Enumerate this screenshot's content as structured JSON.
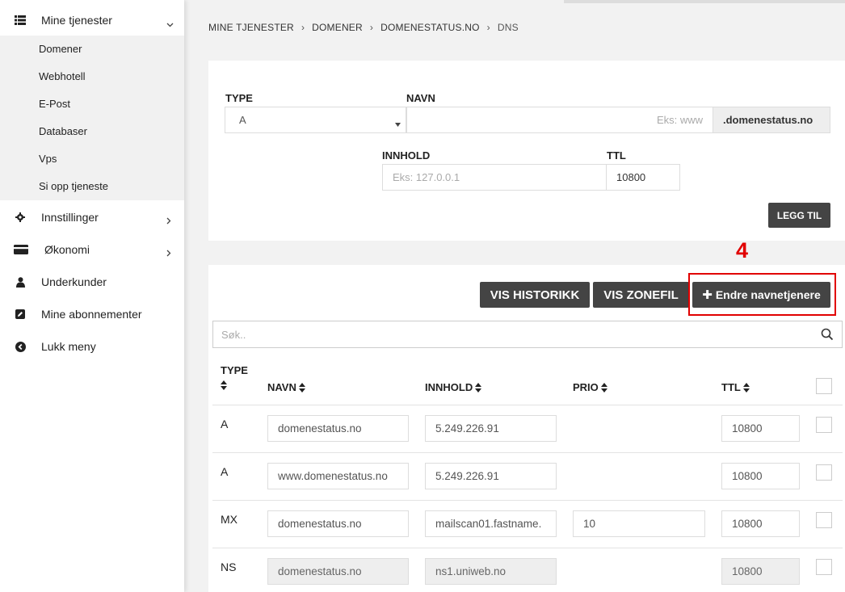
{
  "sidebar": {
    "items": [
      {
        "label": "Mine tjenester",
        "icon": "list-icon"
      },
      {
        "label": "Innstillinger",
        "icon": "gear-icon"
      },
      {
        "label": "Økonomi",
        "icon": "credit-card-icon"
      },
      {
        "label": "Underkunder",
        "icon": "user-icon"
      },
      {
        "label": "Mine abonnementer",
        "icon": "edit-icon"
      },
      {
        "label": "Lukk meny",
        "icon": "chevron-circle-left-icon"
      }
    ],
    "submenu": [
      "Domener",
      "Webhotell",
      "E-Post",
      "Databaser",
      "Vps",
      "Si opp tjeneste"
    ]
  },
  "breadcrumb": [
    "MINE TJENESTER",
    "DOMENER",
    "DOMENESTATUS.NO",
    "DNS"
  ],
  "form": {
    "type_label": "TYPE",
    "type_value": "A",
    "name_label": "NAVN",
    "name_placeholder": "Eks: www",
    "domain_suffix": ".domenestatus.no",
    "content_label": "INNHOLD",
    "content_placeholder": "Eks: 127.0.0.1",
    "ttl_label": "TTL",
    "ttl_value": "10800",
    "add_button": "LEGG TIL"
  },
  "annotation": {
    "step": "4",
    "color": "#e10000"
  },
  "actions": {
    "history": "VIS HISTORIKK",
    "zonefile": "VIS ZONEFIL",
    "change_ns": "Endre navnetjenere"
  },
  "search": {
    "placeholder": "Søk.."
  },
  "table": {
    "headers": {
      "type": "TYPE",
      "name": "NAVN",
      "content": "INNHOLD",
      "prio": "PRIO",
      "ttl": "TTL"
    },
    "rows": [
      {
        "type": "A",
        "name": "domenestatus.no",
        "content": "5.249.226.91",
        "prio": "",
        "ttl": "10800",
        "readonly": false
      },
      {
        "type": "A",
        "name": "www.domenestatus.no",
        "content": "5.249.226.91",
        "prio": "",
        "ttl": "10800",
        "readonly": false
      },
      {
        "type": "MX",
        "name": "domenestatus.no",
        "content": "mailscan01.fastname.",
        "prio": "10",
        "ttl": "10800",
        "readonly": false
      },
      {
        "type": "NS",
        "name": "domenestatus.no",
        "content": "ns1.uniweb.no",
        "prio": "",
        "ttl": "10800",
        "readonly": true
      }
    ]
  }
}
